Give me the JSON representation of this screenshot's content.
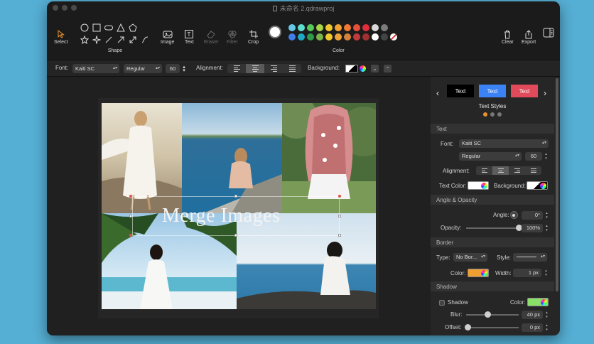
{
  "window": {
    "title": "未命名 2.qdrawproj"
  },
  "toolbar": {
    "select_label": "Select",
    "shape_label": "Shape",
    "image_label": "Image",
    "text_label": "Text",
    "eraser_label": "Eraser",
    "filter_label": "Filter",
    "crop_label": "Crop",
    "color_label": "Color",
    "clear_label": "Clear",
    "export_label": "Export",
    "colors": {
      "current": "#ffffff",
      "row1": [
        "#67c6e6",
        "#5be0d0",
        "#57c95a",
        "#a6d645",
        "#efc62f",
        "#f2a232",
        "#f07a32",
        "#e8503a",
        "#e02f3a",
        "#d8d8d8",
        "#7c7c7c"
      ],
      "row2": [
        "#3f7de8",
        "#1fa8c5",
        "#2e9a4a",
        "#7ab34a",
        "#f2c72b",
        "#eda13a",
        "#d2823a",
        "#c23b3b",
        "#a23030",
        "#ffffff",
        "#444444"
      ]
    }
  },
  "fmtbar": {
    "font_label": "Font:",
    "font_value": "Kaiti SC",
    "weight_value": "Regular",
    "size_value": "60",
    "alignment_label": "Alignment:",
    "background_label": "Background:"
  },
  "canvas": {
    "overlay_text": "Merge Images"
  },
  "panel": {
    "styles": [
      {
        "label": "Text",
        "bg": "#000000"
      },
      {
        "label": "Text",
        "bg": "#3b82f6"
      },
      {
        "label": "Text",
        "bg": "#e04a5a"
      }
    ],
    "styles_title": "Text Styles",
    "sec_text": "Text",
    "font_label": "Font:",
    "font_value": "Kaiti SC",
    "weight_value": "Regular",
    "size_value": "60",
    "alignment_label": "Alignment:",
    "text_color_label": "Text Color:",
    "background_label": "Background:",
    "sec_angle": "Angle & Opacity",
    "angle_label": "Angle:",
    "angle_value": "0°",
    "opacity_label": "Opacity:",
    "opacity_value": "100%",
    "opacity_level": 1.0,
    "sec_border": "Border",
    "type_label": "Type:",
    "type_value": "No Bor...",
    "style_label": "Style:",
    "color_label": "Color:",
    "border_color": "#f0a030",
    "width_label": "Width:",
    "width_value": "1 px",
    "sec_shadow": "Shadow",
    "shadow_label": "Shadow",
    "shadow_color_label": "Color:",
    "shadow_color": "#8be06a",
    "blur_label": "Blur:",
    "blur_value": "40 px",
    "offset_label": "Offset:",
    "offset_value": "0 px"
  }
}
